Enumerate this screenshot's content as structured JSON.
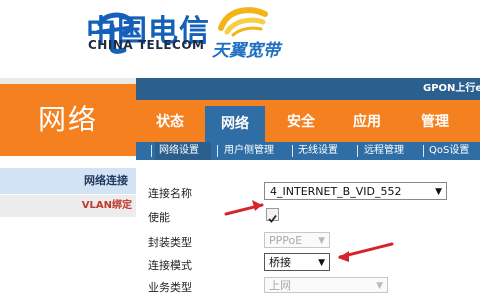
{
  "header": {
    "brand_cn": "中国电信",
    "brand_en": "CHINA TELECOM",
    "tianyi": "天翼宽带"
  },
  "topbar": {
    "text": "GPON上行e"
  },
  "left": {
    "title": "网络",
    "nav": [
      {
        "label": "网络连接"
      },
      {
        "label": "VLAN绑定"
      }
    ]
  },
  "tabs": [
    {
      "label": "状态"
    },
    {
      "label": "网络"
    },
    {
      "label": "安全"
    },
    {
      "label": "应用"
    },
    {
      "label": "管理"
    }
  ],
  "subnav": [
    {
      "label": "网络设置"
    },
    {
      "label": "用户侧管理"
    },
    {
      "label": "无线设置"
    },
    {
      "label": "远程管理"
    },
    {
      "label": "QoS设置"
    }
  ],
  "form": {
    "conn_name_label": "连接名称",
    "conn_name_value": "4_INTERNET_B_VID_552",
    "enable_label": "使能",
    "encap_label": "封装类型",
    "encap_value": "PPPoE",
    "mode_label": "连接模式",
    "mode_value": "桥接",
    "service_label": "业务类型",
    "service_value": "上网"
  },
  "colors": {
    "orange": "#f4801f",
    "blue_dark": "#2b5f8e",
    "blue_mid": "#2f6ea5",
    "annotation_red": "#d8232a"
  }
}
